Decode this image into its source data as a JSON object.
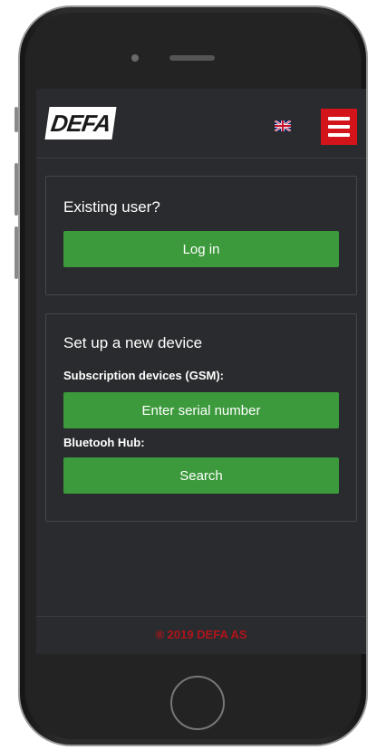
{
  "app": {
    "logo_text": "DEFA",
    "language_flag": "uk-flag-icon",
    "menu_icon": "hamburger-menu-icon",
    "accent_color": "#d3141a",
    "button_color": "#3c9a3c"
  },
  "existing_user": {
    "title": "Existing user?",
    "login_label": "Log in"
  },
  "new_device": {
    "title": "Set up a new device",
    "gsm_label": "Subscription devices (GSM):",
    "serial_button_label": "Enter serial number",
    "bluetooth_label": "Bluetooh Hub:",
    "search_button_label": "Search"
  },
  "footer": {
    "text": "® 2019 DEFA AS"
  }
}
